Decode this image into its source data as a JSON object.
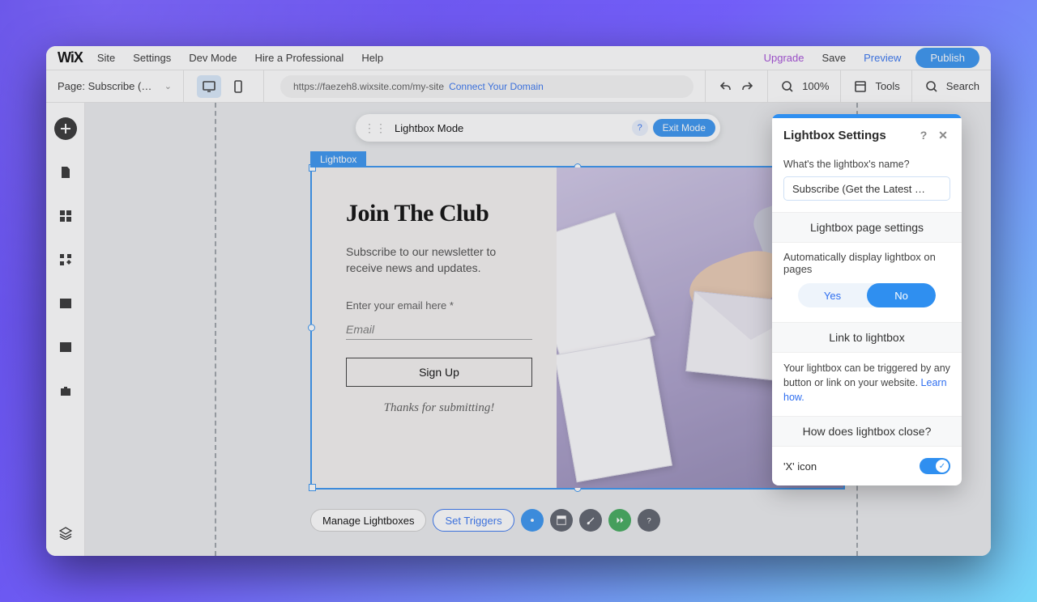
{
  "menubar": {
    "logo": "WiX",
    "items": [
      "Site",
      "Settings",
      "Dev Mode",
      "Hire a Professional",
      "Help"
    ],
    "upgrade": "Upgrade",
    "save": "Save",
    "preview": "Preview",
    "publish": "Publish"
  },
  "toolbar": {
    "page_label": "Page: Subscribe (…",
    "url": "https://faezeh8.wixsite.com/my-site",
    "connect": "Connect Your Domain",
    "zoom": "100%",
    "tools": "Tools",
    "search": "Search"
  },
  "mode_bar": {
    "title": "Lightbox Mode",
    "exit": "Exit Mode"
  },
  "lightbox": {
    "tag": "Lightbox",
    "heading": "Join The Club",
    "subtext": "Subscribe to our newsletter to receive news and updates.",
    "email_label": "Enter your email here *",
    "email_placeholder": "Email",
    "signup": "Sign Up",
    "thanks": "Thanks for submitting!"
  },
  "fab": {
    "manage": "Manage Lightboxes",
    "triggers": "Set Triggers"
  },
  "panel": {
    "title": "Lightbox Settings",
    "name_q": "What's the lightbox's name?",
    "name_val": "Subscribe (Get the Latest …",
    "sec_page": "Lightbox page settings",
    "auto_q": "Automatically display lightbox on pages",
    "yes": "Yes",
    "no": "No",
    "sec_link": "Link to lightbox",
    "link_text": "Your lightbox can be triggered by any button or link on your website. ",
    "learn": "Learn how.",
    "sec_close": "How does lightbox close?",
    "x_icon": "'X' icon"
  }
}
